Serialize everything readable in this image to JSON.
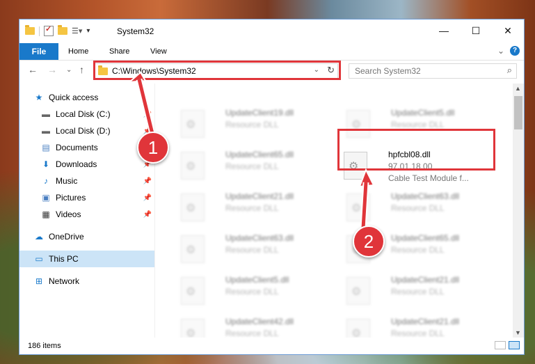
{
  "window": {
    "title": "System32",
    "controls": {
      "minimize": "—",
      "maximize": "☐",
      "close": "✕"
    }
  },
  "ribbon": {
    "tabs": [
      "File",
      "Home",
      "Share",
      "View"
    ],
    "collapse_glyph": "⌄",
    "help_glyph": "?"
  },
  "nav": {
    "back": "←",
    "forward": "→",
    "recent": "⌄",
    "up": "↑",
    "address": "C:\\Windows\\System32",
    "refresh": "↻",
    "search_placeholder": "Search System32"
  },
  "sidebar": {
    "items": [
      {
        "label": "Quick access",
        "icon": "star-icon",
        "glyph": "★",
        "color": "#1979ca",
        "pinned": false
      },
      {
        "label": "Local Disk (C:)",
        "icon": "drive-icon",
        "glyph": "▬",
        "color": "#666666",
        "pinned": true
      },
      {
        "label": "Local Disk (D:)",
        "icon": "drive-icon",
        "glyph": "▬",
        "color": "#666666",
        "pinned": true
      },
      {
        "label": "Documents",
        "icon": "documents-icon",
        "glyph": "▤",
        "color": "#4a7fc1",
        "pinned": true
      },
      {
        "label": "Downloads",
        "icon": "downloads-icon",
        "glyph": "⬇",
        "color": "#1979ca",
        "pinned": true
      },
      {
        "label": "Music",
        "icon": "music-icon",
        "glyph": "♪",
        "color": "#1979ca",
        "pinned": true
      },
      {
        "label": "Pictures",
        "icon": "pictures-icon",
        "glyph": "▣",
        "color": "#4a7fc1",
        "pinned": true
      },
      {
        "label": "Videos",
        "icon": "videos-icon",
        "glyph": "▦",
        "color": "#333333",
        "pinned": true
      },
      {
        "label": "OneDrive",
        "icon": "onedrive-icon",
        "glyph": "☁",
        "color": "#1979ca",
        "pinned": false
      },
      {
        "label": "This PC",
        "icon": "this-pc-icon",
        "glyph": "▭",
        "color": "#1979ca",
        "pinned": false
      },
      {
        "label": "Network",
        "icon": "network-icon",
        "glyph": "⊞",
        "color": "#1979ca",
        "pinned": false
      }
    ],
    "pin_glyph": "📌"
  },
  "files": {
    "left_column": [
      {
        "name": "UpdateClient19.dll",
        "desc": "Resource DLL"
      },
      {
        "name": "UpdateClient65.dll",
        "desc": "Resource DLL"
      },
      {
        "name": "UpdateClient21.dll",
        "desc": "Resource DLL"
      },
      {
        "name": "UpdateClient63.dll",
        "desc": "Resource DLL"
      },
      {
        "name": "UpdateClient5.dll",
        "desc": "Resource DLL"
      },
      {
        "name": "UpdateClient42.dll",
        "desc": "Resource DLL"
      }
    ],
    "right_column": [
      {
        "name": "UpdateClient5.dll",
        "desc": "Resource DLL"
      },
      {
        "name": "UpdateClient63.dll",
        "desc": "Resource DLL"
      },
      {
        "name": "UpdateClient65.dll",
        "desc": "Resource DLL"
      },
      {
        "name": "UpdateClient21.dll",
        "desc": "Resource DLL"
      },
      {
        "name": "UpdateClient21.dll",
        "desc": "Resource DLL"
      }
    ],
    "highlighted": {
      "name": "hpfcbl08.dll",
      "version": "97.01.18.00",
      "description": "Cable Test Module f..."
    }
  },
  "status": {
    "item_count": "186 items"
  },
  "annotations": {
    "step1": "1",
    "step2": "2",
    "color": "#e0353a"
  }
}
